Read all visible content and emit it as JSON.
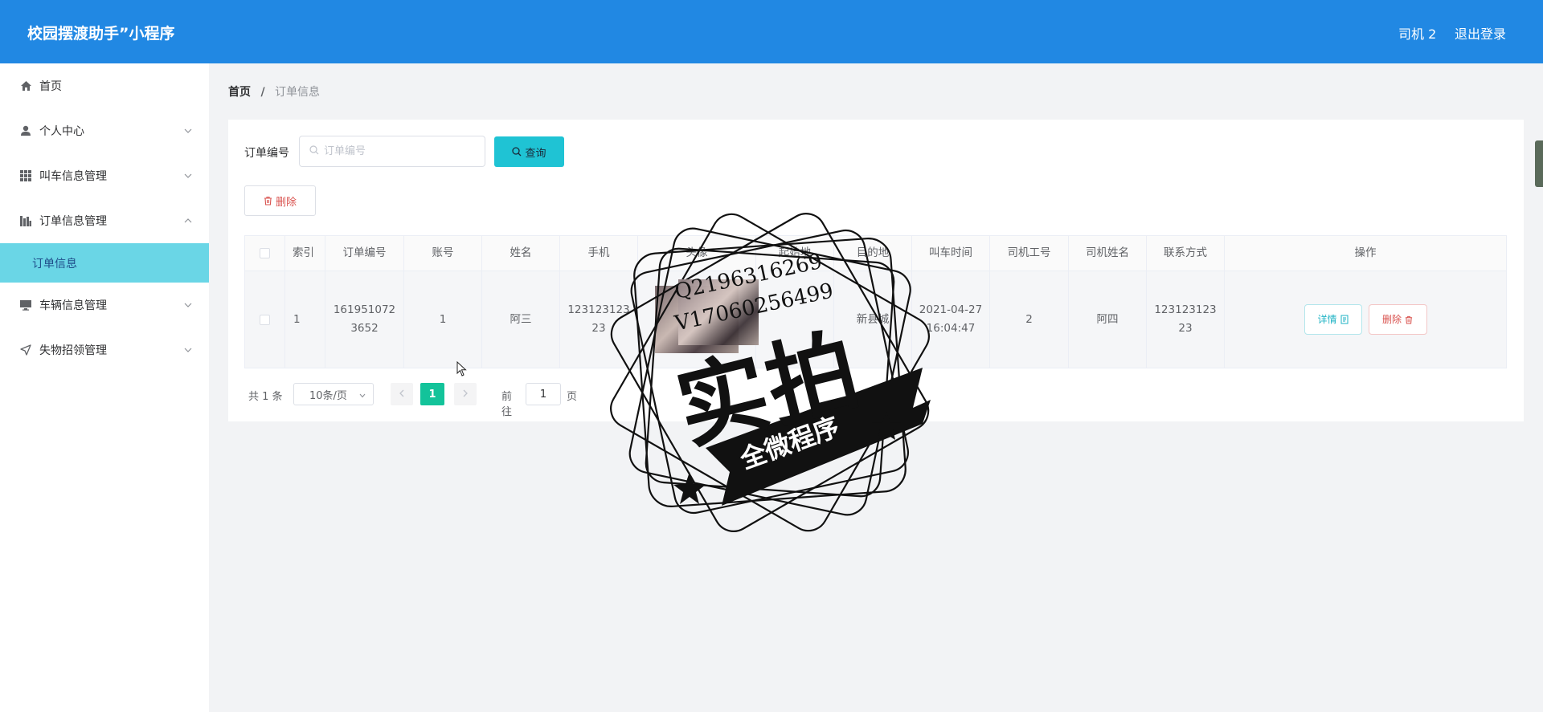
{
  "header": {
    "title": "校园摆渡助手”小程序",
    "user": "司机 2",
    "logout": "退出登录",
    "bg_color": "#2188e3"
  },
  "sidebar": {
    "items": [
      {
        "label": "首页",
        "icon": "home-icon"
      },
      {
        "label": "个人中心",
        "icon": "user-icon"
      },
      {
        "label": "叫车信息管理",
        "icon": "grid-icon"
      },
      {
        "label": "订单信息管理",
        "icon": "chart-icon"
      },
      {
        "label": "车辆信息管理",
        "icon": "monitor-icon"
      },
      {
        "label": "失物招领管理",
        "icon": "send-icon"
      }
    ],
    "active_sub": "订单信息",
    "active_color": "#6ad6e6"
  },
  "breadcrumb": {
    "home": "首页",
    "sep": "/",
    "current": "订单信息"
  },
  "search": {
    "label": "订单编号",
    "placeholder": "订单编号",
    "button": "查询"
  },
  "toolbar": {
    "delete": "删除"
  },
  "table": {
    "columns": [
      "索引",
      "订单编号",
      "账号",
      "姓名",
      "手机",
      "头像",
      "起始地",
      "目的地",
      "叫车时间",
      "司机工号",
      "司机姓名",
      "联系方式",
      "操作"
    ],
    "rows": [
      {
        "index": "1",
        "order_no": "1619510723652",
        "account": "1",
        "name": "阿三",
        "phone": "12312312323",
        "origin": "",
        "destination": "新县城",
        "time": "2021-04-27 16:04:47",
        "driver_no": "2",
        "driver_name": "阿四",
        "contact": "12312312323",
        "detail": "详情",
        "delete": "删除"
      }
    ]
  },
  "pagination": {
    "total": "共 1 条",
    "page_size": "10条/页",
    "current": "1",
    "goto": "前往",
    "goto_value": "1",
    "page_suffix": "页",
    "active_color": "#13c39a"
  },
  "watermark": {
    "line1": "Q2196316269",
    "line2": "V17060256499",
    "big": "实拍",
    "banner": "全微程序"
  }
}
